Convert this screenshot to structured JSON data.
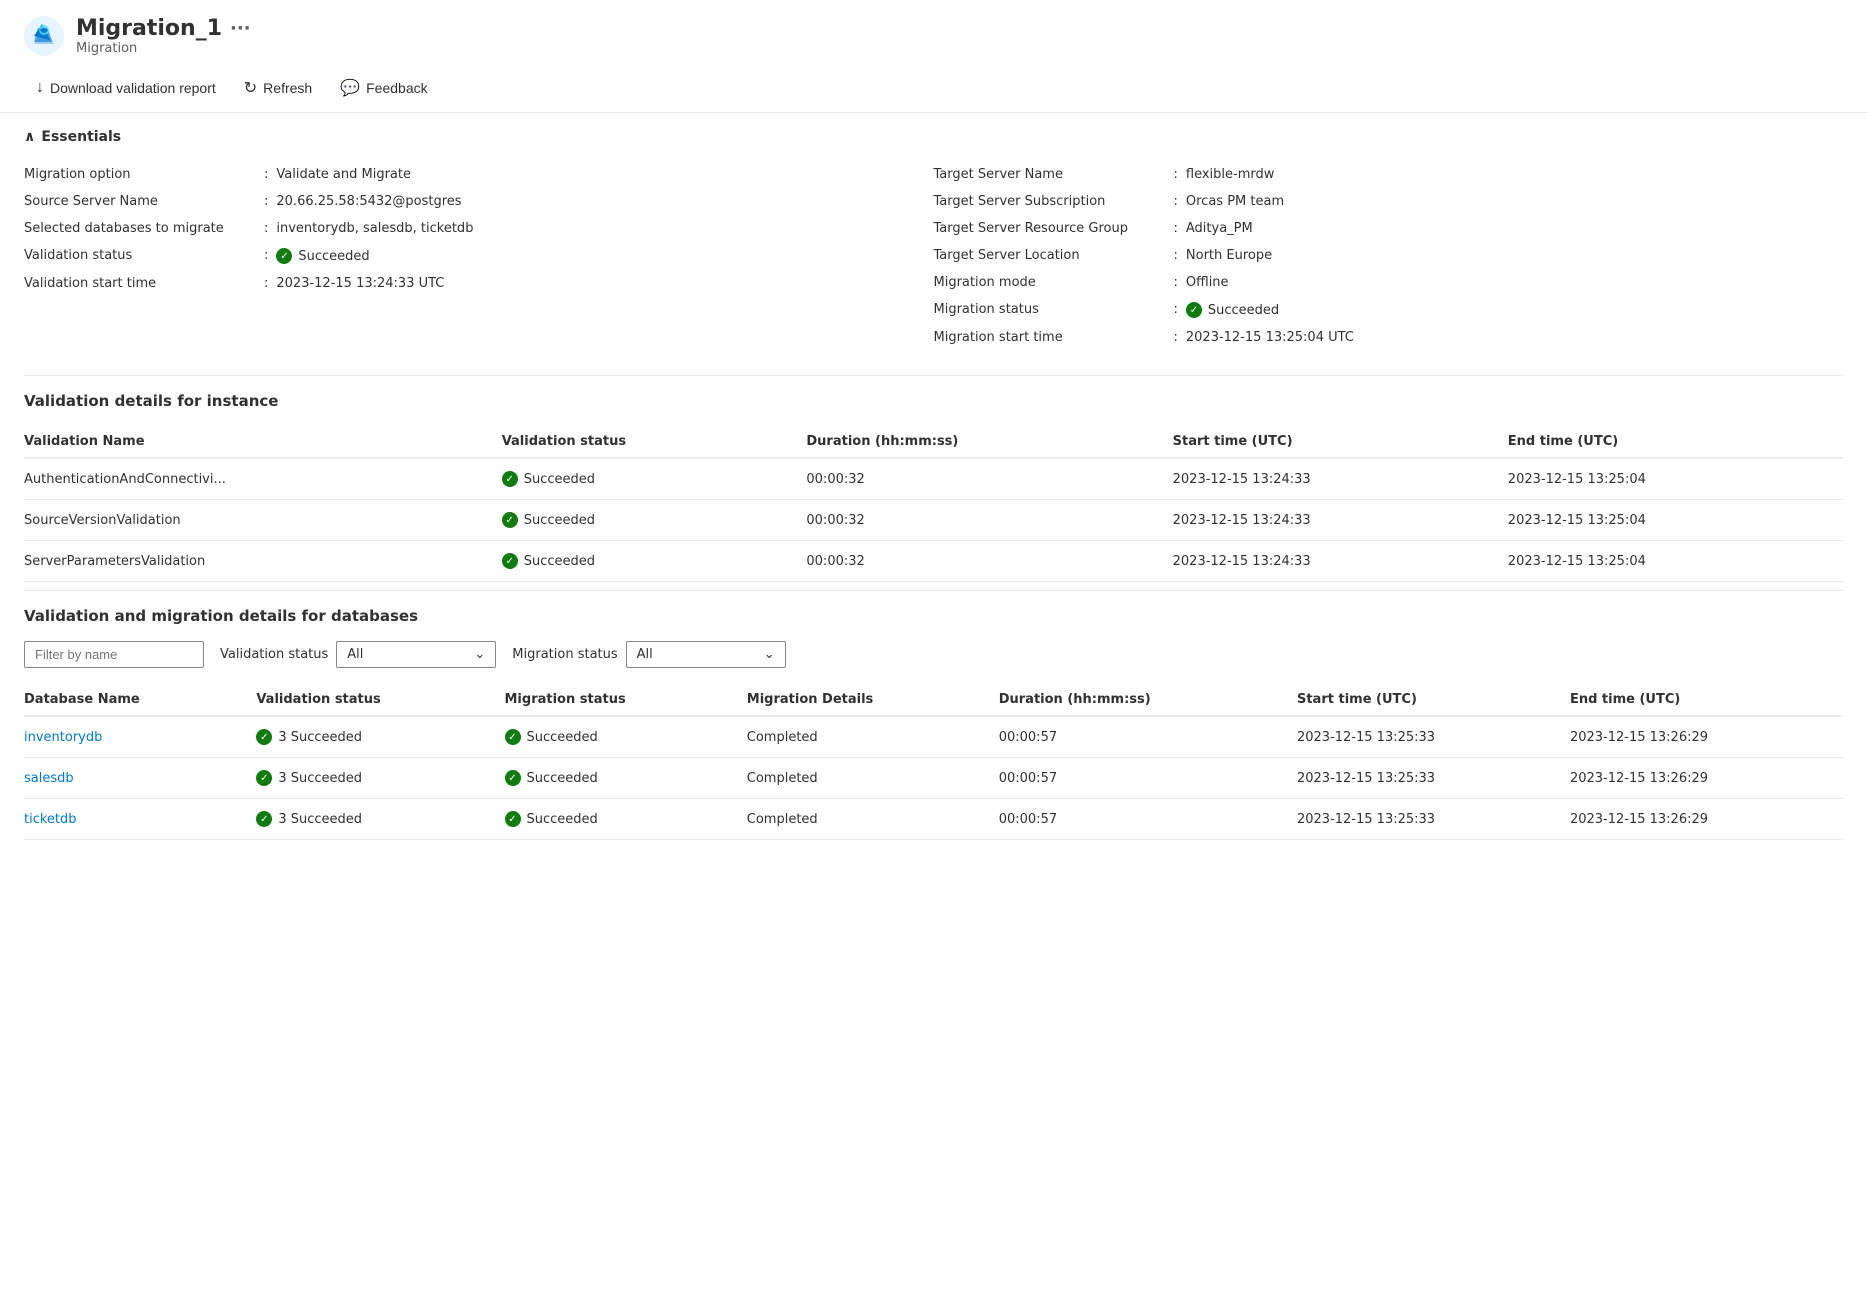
{
  "header": {
    "title": "Migration_1",
    "subtitle": "Migration",
    "ellipsis": "···"
  },
  "toolbar": {
    "download_label": "Download validation report",
    "refresh_label": "Refresh",
    "feedback_label": "Feedback"
  },
  "essentials": {
    "section_label": "Essentials",
    "left_rows": [
      {
        "label": "Migration option",
        "value": "Validate and Migrate"
      },
      {
        "label": "Source Server Name",
        "value": "20.66.25.58:5432@postgres"
      },
      {
        "label": "Selected databases to migrate",
        "value": "inventorydb, salesdb, ticketdb"
      },
      {
        "label": "Validation status",
        "value": "Succeeded",
        "has_icon": true
      },
      {
        "label": "Validation start time",
        "value": "2023-12-15 13:24:33 UTC"
      }
    ],
    "right_rows": [
      {
        "label": "Target Server Name",
        "value": "flexible-mrdw"
      },
      {
        "label": "Target Server Subscription",
        "value": "Orcas PM team"
      },
      {
        "label": "Target Server Resource Group",
        "value": "Aditya_PM"
      },
      {
        "label": "Target Server Location",
        "value": "North Europe"
      },
      {
        "label": "Migration mode",
        "value": "Offline"
      },
      {
        "label": "Migration status",
        "value": "Succeeded",
        "has_icon": true
      },
      {
        "label": "Migration start time",
        "value": "2023-12-15 13:25:04 UTC"
      }
    ]
  },
  "validation_instance": {
    "section_title": "Validation details for instance",
    "columns": [
      "Validation Name",
      "Validation status",
      "Duration (hh:mm:ss)",
      "Start time (UTC)",
      "End time (UTC)"
    ],
    "rows": [
      {
        "name": "AuthenticationAndConnectivi...",
        "status": "Succeeded",
        "duration": "00:00:32",
        "start_time": "2023-12-15 13:24:33",
        "end_time": "2023-12-15 13:25:04"
      },
      {
        "name": "SourceVersionValidation",
        "status": "Succeeded",
        "duration": "00:00:32",
        "start_time": "2023-12-15 13:24:33",
        "end_time": "2023-12-15 13:25:04"
      },
      {
        "name": "ServerParametersValidation",
        "status": "Succeeded",
        "duration": "00:00:32",
        "start_time": "2023-12-15 13:24:33",
        "end_time": "2023-12-15 13:25:04"
      }
    ]
  },
  "validation_databases": {
    "section_title": "Validation and migration details for databases",
    "filter_placeholder": "Filter by name",
    "validation_status_label": "Validation status",
    "migration_status_label": "Migration status",
    "filter_all": "All",
    "columns": [
      "Database Name",
      "Validation status",
      "Migration status",
      "Migration Details",
      "Duration (hh:mm:ss)",
      "Start time (UTC)",
      "End time (UTC)"
    ],
    "rows": [
      {
        "name": "inventorydb",
        "validation_status": "3 Succeeded",
        "migration_status": "Succeeded",
        "migration_details": "Completed",
        "duration": "00:00:57",
        "start_time": "2023-12-15 13:25:33",
        "end_time": "2023-12-15 13:26:29"
      },
      {
        "name": "salesdb",
        "validation_status": "3 Succeeded",
        "migration_status": "Succeeded",
        "migration_details": "Completed",
        "duration": "00:00:57",
        "start_time": "2023-12-15 13:25:33",
        "end_time": "2023-12-15 13:26:29"
      },
      {
        "name": "ticketdb",
        "validation_status": "3 Succeeded",
        "migration_status": "Succeeded",
        "migration_details": "Completed",
        "duration": "00:00:57",
        "start_time": "2023-12-15 13:25:33",
        "end_time": "2023-12-15 13:26:29"
      }
    ]
  }
}
